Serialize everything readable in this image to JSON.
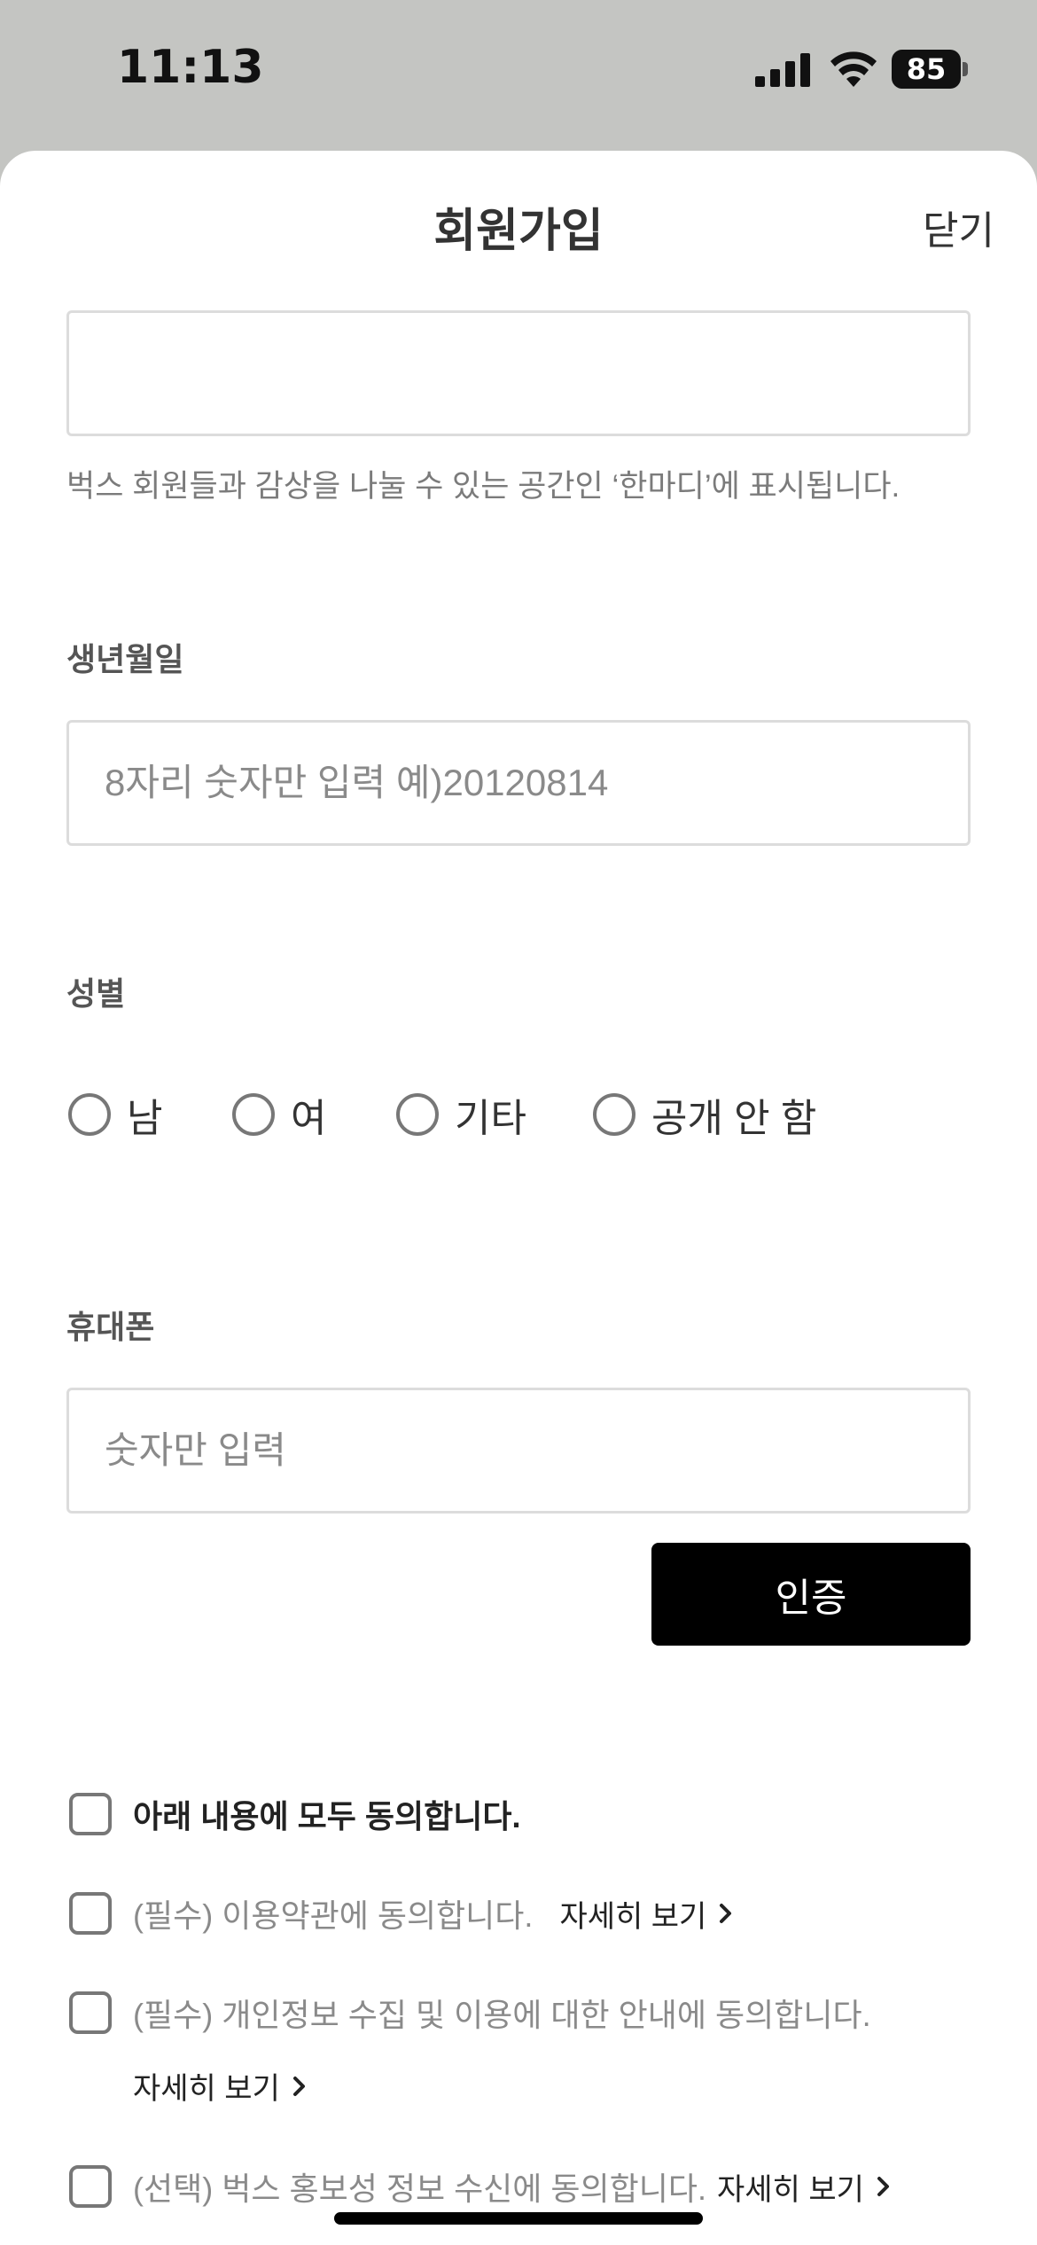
{
  "status_bar": {
    "time": "11:13",
    "battery": "85"
  },
  "header": {
    "title": "회원가입",
    "close_label": "닫기"
  },
  "nickname": {
    "value": "",
    "help": "벅스 회원들과 감상을 나눌 수 있는 공간인 ‘한마디’에 표시됩니다."
  },
  "birthdate": {
    "label": "생년월일",
    "placeholder": "8자리 숫자만 입력 예)20120814"
  },
  "gender": {
    "label": "성별",
    "options": [
      "남",
      "여",
      "기타",
      "공개 안 함"
    ]
  },
  "phone": {
    "label": "휴대폰",
    "placeholder": "숫자만 입력",
    "verify_label": "인증"
  },
  "agreements": {
    "all": "아래 내용에 모두 동의합니다.",
    "items": [
      {
        "text": "(필수) 이용약관에 동의합니다.",
        "link": "자세히 보기"
      },
      {
        "text": "(필수) 개인정보 수집 및 이용에 대한 안내에 동의합니다.",
        "link": "자세히 보기"
      },
      {
        "text": "(선택) 벅스 홍보성 정보 수신에 동의합니다.",
        "link": "자세히 보기"
      }
    ]
  },
  "icons": {
    "signal": "signal-icon",
    "wifi": "wifi-icon",
    "battery": "battery-icon",
    "chevron": "chevron-right-icon"
  }
}
